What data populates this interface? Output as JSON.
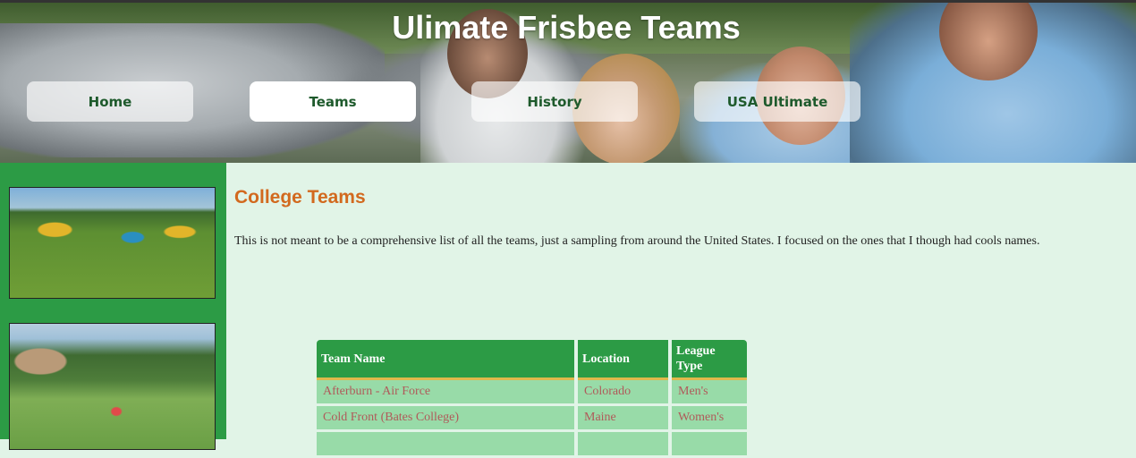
{
  "site": {
    "title": "Ulimate Frisbee Teams"
  },
  "nav": {
    "items": [
      {
        "label": "Home",
        "active": false
      },
      {
        "label": "Teams",
        "active": true
      },
      {
        "label": "History",
        "active": false
      },
      {
        "label": "USA Ultimate",
        "active": false
      }
    ]
  },
  "main": {
    "section_title": "College Teams",
    "intro": "This is not meant to be a comprehensive list of all the teams, just a sampling from around the United States. I focused on the ones that I though had cools names.",
    "table": {
      "headers": [
        "Team Name",
        "Location",
        "League Type"
      ],
      "rows": [
        [
          "Afterburn - Air Force",
          "Colorado",
          "Men's"
        ],
        [
          "Cold Front (Bates College)",
          "Maine",
          "Women's"
        ]
      ]
    }
  },
  "colors": {
    "sidebar": "#2c9b45",
    "content_bg": "#e1f4e7",
    "heading": "#d2691e",
    "table_header": "#2c9b45",
    "table_row": "#98dba8",
    "nav_text": "#1e5a2c"
  }
}
